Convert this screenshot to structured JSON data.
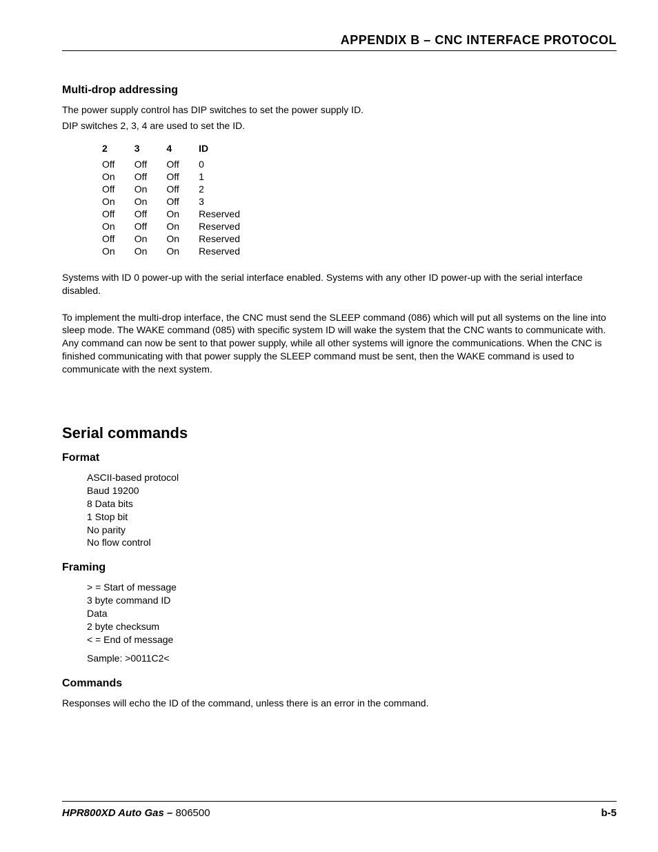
{
  "header": {
    "appendix_title": "APPENDIX B – CNC INTERFACE PROTOCOL"
  },
  "multidrop": {
    "heading": "Multi-drop addressing",
    "intro1": "The power supply control has DIP switches to set the power supply ID.",
    "intro2": "DIP switches 2, 3, 4 are used to set the ID.",
    "table": {
      "headers": [
        "2",
        "3",
        "4",
        "ID"
      ],
      "rows": [
        [
          "Off",
          "Off",
          "Off",
          "0"
        ],
        [
          "On",
          "Off",
          "Off",
          "1"
        ],
        [
          "Off",
          "On",
          "Off",
          "2"
        ],
        [
          "On",
          "On",
          "Off",
          "3"
        ],
        [
          "Off",
          "Off",
          "On",
          "Reserved"
        ],
        [
          "On",
          "Off",
          "On",
          "Reserved"
        ],
        [
          "Off",
          "On",
          "On",
          "Reserved"
        ],
        [
          "On",
          "On",
          "On",
          "Reserved"
        ]
      ]
    },
    "para1": "Systems with ID 0 power-up with the serial interface enabled. Systems with any other ID power-up with the serial interface disabled.",
    "para2": "To implement the multi-drop interface, the CNC must send the SLEEP command (086) which will put all systems on the line into sleep mode. The WAKE command (085) with specific system ID will wake the system that the CNC wants to communicate with. Any command can now be sent to that power supply, while all other systems will ignore the communications. When the CNC is finished communicating with that power supply the SLEEP command must be sent, then the WAKE command is used to communicate with the next system."
  },
  "serial": {
    "heading": "Serial commands",
    "format": {
      "heading": "Format",
      "lines": [
        "ASCII-based protocol",
        "Baud 19200",
        "8 Data bits",
        "1 Stop bit",
        "No parity",
        "No flow control"
      ]
    },
    "framing": {
      "heading": "Framing",
      "lines": [
        "> = Start of message",
        "3 byte command ID",
        "Data",
        "2 byte checksum",
        "< = End of message"
      ],
      "sample": "Sample: >0011C2<"
    },
    "commands": {
      "heading": "Commands",
      "text": "Responses will echo the ID of the command, unless there is an error in the command."
    }
  },
  "footer": {
    "product": "HPR800XD Auto Gas",
    "separator": " – ",
    "docnum": "806500",
    "page": "b-5"
  }
}
